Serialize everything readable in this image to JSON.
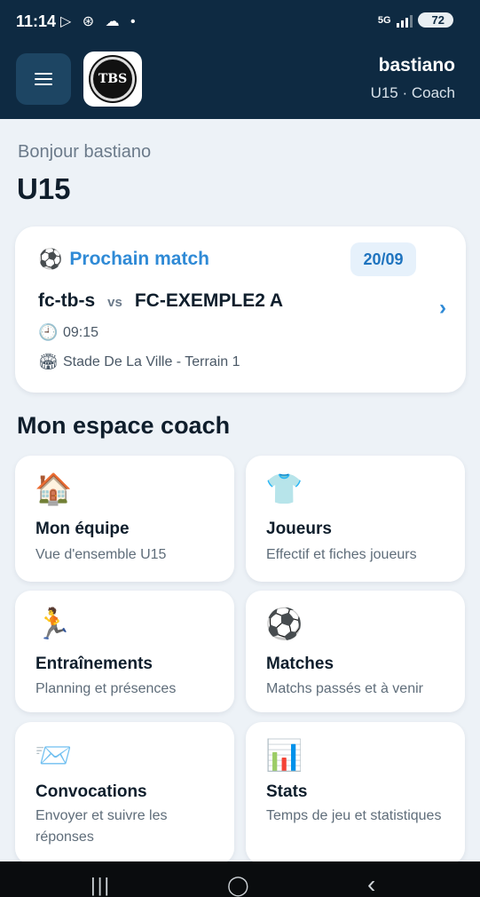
{
  "status_bar": {
    "time": "11:14",
    "notification_icons": "▷ ⊛ ☁ •",
    "network": "5G",
    "battery": "72"
  },
  "header": {
    "menu_icon": "hamburger-menu-icon",
    "logo_text": "TBS",
    "user_name": "bastiano",
    "user_role": "U15 · Coach"
  },
  "greeting": "Bonjour bastiano",
  "team_name": "U15",
  "next_match": {
    "icon": "⚽",
    "label": "Prochain match",
    "date": "20/09",
    "home": "fc-tb-s",
    "vs": "vs",
    "away": "FC-EXEMPLE2 A",
    "time_icon": "🕘",
    "time": "09:15",
    "venue_icon": "🏟",
    "venue": "Stade De La Ville - Terrain 1",
    "chevron": "›"
  },
  "section_title": "Mon espace coach",
  "tiles": [
    {
      "icon": "🏠",
      "title": "Mon équipe",
      "subtitle": "Vue d'ensemble U15"
    },
    {
      "icon": "👕",
      "title": "Joueurs",
      "subtitle": "Effectif et fiches joueurs"
    },
    {
      "icon": "🏃",
      "title": "Entraînements",
      "subtitle": "Planning et présences"
    },
    {
      "icon": "⚽",
      "title": "Matches",
      "subtitle": "Matchs passés et à venir"
    },
    {
      "icon": "📨",
      "title": "Convocations",
      "subtitle": "Envoyer et suivre les réponses"
    },
    {
      "icon": "📊",
      "title": "Stats",
      "subtitle": "Temps de jeu et statistiques"
    }
  ],
  "nav_bar": {
    "recents": "|||",
    "home": "◯",
    "back": "‹"
  }
}
